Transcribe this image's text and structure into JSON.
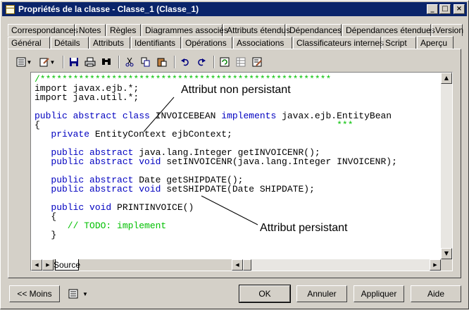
{
  "window": {
    "title": "Propriétés de la classe - Classe_1 (Classe_1)",
    "minimize_glyph": "_",
    "maximize_glyph": "□",
    "close_glyph": "×"
  },
  "tabs_row1": [
    {
      "label": "Correspondances"
    },
    {
      "label": "Notes"
    },
    {
      "label": "Règles"
    },
    {
      "label": "Diagrammes associés"
    },
    {
      "label": "Attributs étendus"
    },
    {
      "label": "Dépendances"
    },
    {
      "label": "Dépendances étendues"
    },
    {
      "label": "Version"
    }
  ],
  "tabs_row2": [
    {
      "label": "Général"
    },
    {
      "label": "Détails"
    },
    {
      "label": "Attributs"
    },
    {
      "label": "Identifiants"
    },
    {
      "label": "Opérations"
    },
    {
      "label": "Associations"
    },
    {
      "label": "Classificateurs internes"
    },
    {
      "label": "Script"
    },
    {
      "label": "Aperçu",
      "active": true
    }
  ],
  "toolbar_icons": [
    "properties-menu-icon",
    "edit-menu-icon",
    "save-icon",
    "print-icon",
    "find-icon",
    "cut-icon",
    "copy-icon",
    "paste-icon",
    "undo-icon",
    "redo-icon",
    "refresh-icon",
    "table-icon",
    "edit-window-icon"
  ],
  "code": {
    "line1": "/*****************************************************",
    "line2": "import javax.ejb.*;",
    "line3": "import java.util.*;",
    "line5_kw": "public abstract class ",
    "line5_name": "INVOICEBEAN ",
    "line5_kw2": "implements",
    "line5_rest": " javax.ejb.EntityBean",
    "line6": "{",
    "line6_tail": "***",
    "line7_kw": "   private ",
    "line7_rest": "EntityContext ejbContext;",
    "line9_kw": "   public abstract ",
    "line9_rest": "java.lang.Integer getINVOICENR();",
    "line10_kw": "   public abstract void ",
    "line10_rest": "setINVOICENR(java.lang.Integer INVOICENR);",
    "line12_kw": "   public abstract ",
    "line12_rest": "Date getSHIPDATE();",
    "line13_kw": "   public abstract void ",
    "line13_rest": "setSHIPDATE(Date SHIPDATE);",
    "line15_kw": "   public void ",
    "line15_rest": "PRINTINVOICE()",
    "line16": "   {",
    "line17": "      // TODO: implement",
    "line18": "   }"
  },
  "annotations": {
    "non_persistent": "Attribut non persistant",
    "persistent": "Attribut persistant"
  },
  "editor_tab": "Source",
  "footer": {
    "less": "<< Moins",
    "ok": "OK",
    "cancel": "Annuler",
    "apply": "Appliquer",
    "help": "Aide"
  }
}
